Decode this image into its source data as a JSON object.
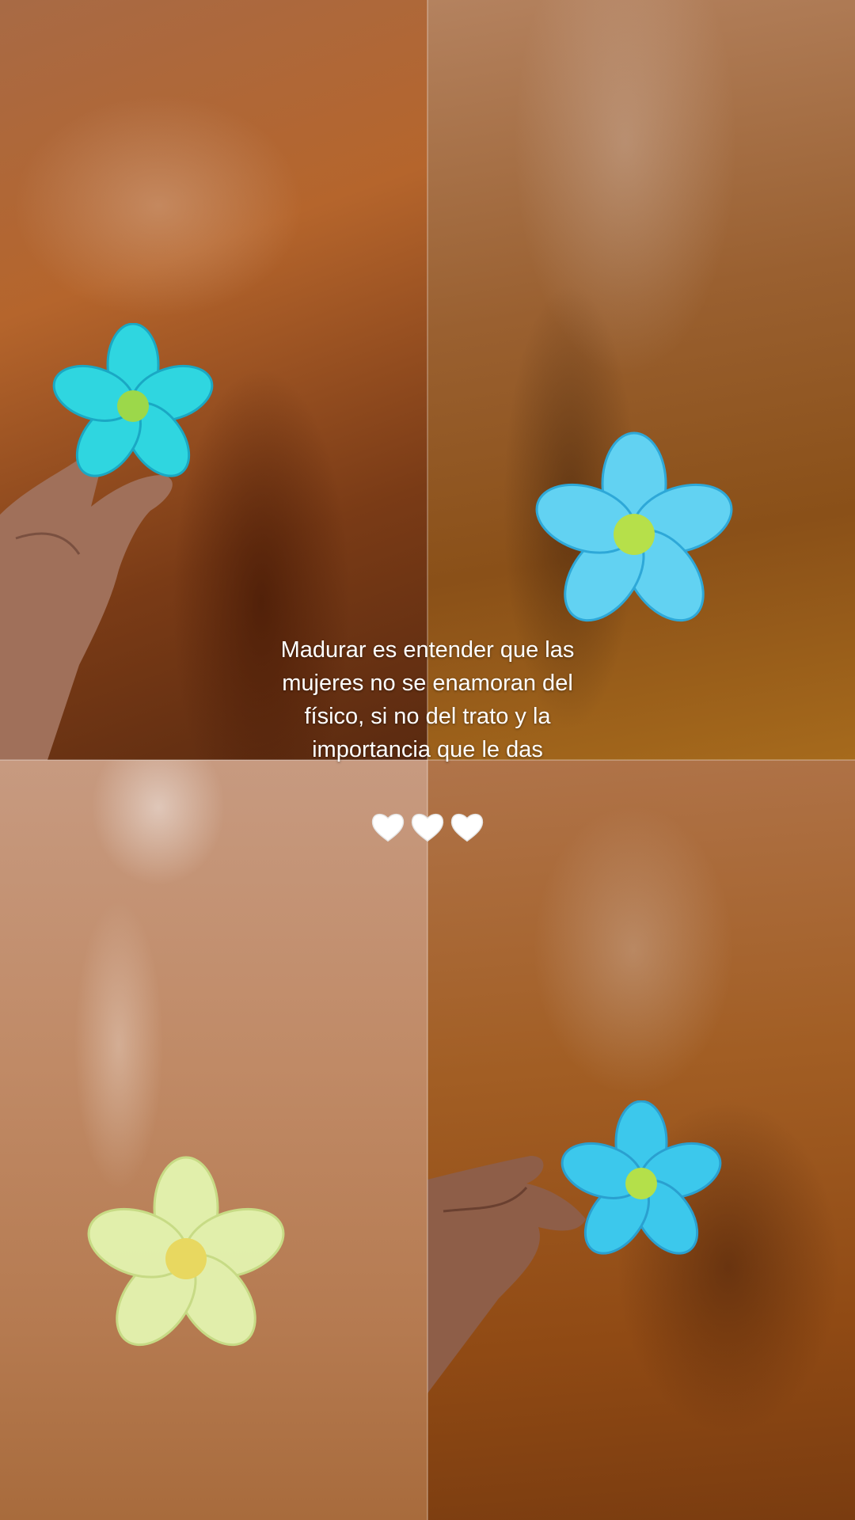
{
  "caption": {
    "text": "Madurar es entender que las\nmujeres no se enamoran del\nfísico, si no del trato y la\nimportancia que le das"
  },
  "hearts": {
    "count": 3,
    "icon": "white-heart-icon",
    "color": "#ffffff"
  },
  "panels": [
    {
      "name": "top-left",
      "flower_color": "#2fd6e0"
    },
    {
      "name": "top-right",
      "flower_color": "#48c8ec"
    },
    {
      "name": "bottom-left",
      "flower_color": "#e4f5b0"
    },
    {
      "name": "bottom-right",
      "flower_color": "#3cc8ec"
    }
  ]
}
